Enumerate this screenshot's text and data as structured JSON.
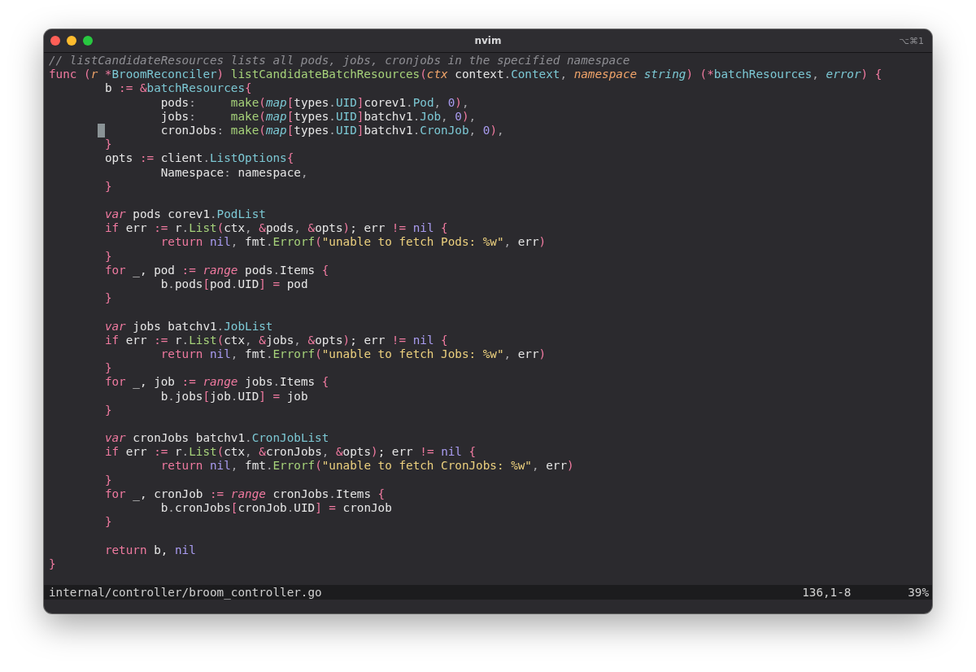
{
  "window": {
    "title": "nvim",
    "shortcut": "⌥⌘1"
  },
  "lines": [
    {
      "kind": "code",
      "cursor": false,
      "tokens": [
        {
          "text": "// listCandidateResources lists all pods, jobs, cronjobs in the specified namespace",
          "kind": "comment"
        }
      ]
    },
    {
      "kind": "code",
      "cursor": false,
      "tokens": [
        {
          "text": "func",
          "kind": "keyword"
        },
        {
          "text": " (",
          "kind": "op"
        },
        {
          "text": "r",
          "kind": "param"
        },
        {
          "text": " *",
          "kind": "op"
        },
        {
          "text": "BroomReconciler",
          "kind": "type"
        },
        {
          "text": ") ",
          "kind": "op"
        },
        {
          "text": "listCandidateBatchResources",
          "kind": "func"
        },
        {
          "text": "(",
          "kind": "op"
        },
        {
          "text": "ctx",
          "kind": "param"
        },
        {
          "text": " context",
          "kind": "plain"
        },
        {
          "text": ".",
          "kind": "punct"
        },
        {
          "text": "Context",
          "kind": "type"
        },
        {
          "text": ", ",
          "kind": "punct"
        },
        {
          "text": "namespace",
          "kind": "param"
        },
        {
          "text": " string",
          "kind": "type-italic"
        },
        {
          "text": ") (*",
          "kind": "op"
        },
        {
          "text": "batchResources",
          "kind": "type"
        },
        {
          "text": ", ",
          "kind": "punct"
        },
        {
          "text": "error",
          "kind": "type-italic"
        },
        {
          "text": ") {",
          "kind": "op"
        }
      ]
    },
    {
      "kind": "code",
      "cursor": false,
      "tokens": [
        {
          "text": "\tb ",
          "kind": "plain"
        },
        {
          "text": ":= &",
          "kind": "op"
        },
        {
          "text": "batchResources",
          "kind": "type"
        },
        {
          "text": "{",
          "kind": "op"
        }
      ]
    },
    {
      "kind": "code",
      "cursor": false,
      "tokens": [
        {
          "text": "\t\tpods",
          "kind": "plain"
        },
        {
          "text": ":     ",
          "kind": "punct"
        },
        {
          "text": "make",
          "kind": "func"
        },
        {
          "text": "(",
          "kind": "op"
        },
        {
          "text": "map",
          "kind": "type-italic"
        },
        {
          "text": "[",
          "kind": "op"
        },
        {
          "text": "types",
          "kind": "plain"
        },
        {
          "text": ".",
          "kind": "punct"
        },
        {
          "text": "UID",
          "kind": "type"
        },
        {
          "text": "]",
          "kind": "op"
        },
        {
          "text": "corev1",
          "kind": "plain"
        },
        {
          "text": ".",
          "kind": "punct"
        },
        {
          "text": "Pod",
          "kind": "type"
        },
        {
          "text": ", ",
          "kind": "punct"
        },
        {
          "text": "0",
          "kind": "const"
        },
        {
          "text": ")",
          "kind": "op"
        },
        {
          "text": ",",
          "kind": "punct"
        }
      ]
    },
    {
      "kind": "code",
      "cursor": false,
      "tokens": [
        {
          "text": "\t\tjobs",
          "kind": "plain"
        },
        {
          "text": ":     ",
          "kind": "punct"
        },
        {
          "text": "make",
          "kind": "func"
        },
        {
          "text": "(",
          "kind": "op"
        },
        {
          "text": "map",
          "kind": "type-italic"
        },
        {
          "text": "[",
          "kind": "op"
        },
        {
          "text": "types",
          "kind": "plain"
        },
        {
          "text": ".",
          "kind": "punct"
        },
        {
          "text": "UID",
          "kind": "type"
        },
        {
          "text": "]",
          "kind": "op"
        },
        {
          "text": "batchv1",
          "kind": "plain"
        },
        {
          "text": ".",
          "kind": "punct"
        },
        {
          "text": "Job",
          "kind": "type"
        },
        {
          "text": ", ",
          "kind": "punct"
        },
        {
          "text": "0",
          "kind": "const"
        },
        {
          "text": ")",
          "kind": "op"
        },
        {
          "text": ",",
          "kind": "punct"
        }
      ]
    },
    {
      "kind": "code",
      "cursor": true,
      "tokens": [
        {
          "text": "\t\tcronJobs",
          "kind": "plain"
        },
        {
          "text": ": ",
          "kind": "punct"
        },
        {
          "text": "make",
          "kind": "func"
        },
        {
          "text": "(",
          "kind": "op"
        },
        {
          "text": "map",
          "kind": "type-italic"
        },
        {
          "text": "[",
          "kind": "op"
        },
        {
          "text": "types",
          "kind": "plain"
        },
        {
          "text": ".",
          "kind": "punct"
        },
        {
          "text": "UID",
          "kind": "type"
        },
        {
          "text": "]",
          "kind": "op"
        },
        {
          "text": "batchv1",
          "kind": "plain"
        },
        {
          "text": ".",
          "kind": "punct"
        },
        {
          "text": "CronJob",
          "kind": "type"
        },
        {
          "text": ", ",
          "kind": "punct"
        },
        {
          "text": "0",
          "kind": "const"
        },
        {
          "text": ")",
          "kind": "op"
        },
        {
          "text": ",",
          "kind": "punct"
        }
      ]
    },
    {
      "kind": "code",
      "cursor": false,
      "tokens": [
        {
          "text": "\t}",
          "kind": "op"
        }
      ]
    },
    {
      "kind": "code",
      "cursor": false,
      "tokens": [
        {
          "text": "\topts ",
          "kind": "plain"
        },
        {
          "text": ":= ",
          "kind": "op"
        },
        {
          "text": "client",
          "kind": "plain"
        },
        {
          "text": ".",
          "kind": "punct"
        },
        {
          "text": "ListOptions",
          "kind": "type"
        },
        {
          "text": "{",
          "kind": "op"
        }
      ]
    },
    {
      "kind": "code",
      "cursor": false,
      "tokens": [
        {
          "text": "\t\tNamespace",
          "kind": "plain"
        },
        {
          "text": ": ",
          "kind": "punct"
        },
        {
          "text": "namespace",
          "kind": "plain"
        },
        {
          "text": ",",
          "kind": "punct"
        }
      ]
    },
    {
      "kind": "code",
      "cursor": false,
      "tokens": [
        {
          "text": "\t}",
          "kind": "op"
        }
      ]
    },
    {
      "kind": "blank"
    },
    {
      "kind": "code",
      "cursor": false,
      "tokens": [
        {
          "text": "\tvar",
          "kind": "keyword-italic"
        },
        {
          "text": " pods corev1",
          "kind": "plain"
        },
        {
          "text": ".",
          "kind": "punct"
        },
        {
          "text": "PodList",
          "kind": "type"
        }
      ]
    },
    {
      "kind": "code",
      "cursor": false,
      "tokens": [
        {
          "text": "\tif",
          "kind": "keyword"
        },
        {
          "text": " err ",
          "kind": "plain"
        },
        {
          "text": ":= ",
          "kind": "op"
        },
        {
          "text": "r",
          "kind": "plain"
        },
        {
          "text": ".",
          "kind": "punct"
        },
        {
          "text": "List",
          "kind": "func"
        },
        {
          "text": "(",
          "kind": "op"
        },
        {
          "text": "ctx",
          "kind": "plain"
        },
        {
          "text": ", ",
          "kind": "punct"
        },
        {
          "text": "&",
          "kind": "op"
        },
        {
          "text": "pods",
          "kind": "plain"
        },
        {
          "text": ", ",
          "kind": "punct"
        },
        {
          "text": "&",
          "kind": "op"
        },
        {
          "text": "opts",
          "kind": "plain"
        },
        {
          "text": ")",
          "kind": "op"
        },
        {
          "text": "; err ",
          "kind": "plain"
        },
        {
          "text": "!= ",
          "kind": "op"
        },
        {
          "text": "nil",
          "kind": "const"
        },
        {
          "text": " {",
          "kind": "op"
        }
      ]
    },
    {
      "kind": "code",
      "cursor": false,
      "tokens": [
        {
          "text": "\t\treturn",
          "kind": "keyword"
        },
        {
          "text": " nil",
          "kind": "const"
        },
        {
          "text": ", ",
          "kind": "punct"
        },
        {
          "text": "fmt",
          "kind": "plain"
        },
        {
          "text": ".",
          "kind": "punct"
        },
        {
          "text": "Errorf",
          "kind": "func"
        },
        {
          "text": "(",
          "kind": "op"
        },
        {
          "text": "\"unable to fetch Pods: %w\"",
          "kind": "string"
        },
        {
          "text": ", ",
          "kind": "punct"
        },
        {
          "text": "err",
          "kind": "plain"
        },
        {
          "text": ")",
          "kind": "op"
        }
      ]
    },
    {
      "kind": "code",
      "cursor": false,
      "tokens": [
        {
          "text": "\t}",
          "kind": "op"
        }
      ]
    },
    {
      "kind": "code",
      "cursor": false,
      "tokens": [
        {
          "text": "\tfor",
          "kind": "keyword"
        },
        {
          "text": " _, pod ",
          "kind": "plain"
        },
        {
          "text": ":= ",
          "kind": "op"
        },
        {
          "text": "range",
          "kind": "keyword-italic"
        },
        {
          "text": " pods",
          "kind": "plain"
        },
        {
          "text": ".",
          "kind": "punct"
        },
        {
          "text": "Items",
          "kind": "plain"
        },
        {
          "text": " {",
          "kind": "op"
        }
      ]
    },
    {
      "kind": "code",
      "cursor": false,
      "tokens": [
        {
          "text": "\t\tb",
          "kind": "plain"
        },
        {
          "text": ".",
          "kind": "punct"
        },
        {
          "text": "pods",
          "kind": "plain"
        },
        {
          "text": "[",
          "kind": "op"
        },
        {
          "text": "pod",
          "kind": "plain"
        },
        {
          "text": ".",
          "kind": "punct"
        },
        {
          "text": "UID",
          "kind": "plain"
        },
        {
          "text": "] = ",
          "kind": "op"
        },
        {
          "text": "pod",
          "kind": "plain"
        }
      ]
    },
    {
      "kind": "code",
      "cursor": false,
      "tokens": [
        {
          "text": "\t}",
          "kind": "op"
        }
      ]
    },
    {
      "kind": "blank"
    },
    {
      "kind": "code",
      "cursor": false,
      "tokens": [
        {
          "text": "\tvar",
          "kind": "keyword-italic"
        },
        {
          "text": " jobs batchv1",
          "kind": "plain"
        },
        {
          "text": ".",
          "kind": "punct"
        },
        {
          "text": "JobList",
          "kind": "type"
        }
      ]
    },
    {
      "kind": "code",
      "cursor": false,
      "tokens": [
        {
          "text": "\tif",
          "kind": "keyword"
        },
        {
          "text": " err ",
          "kind": "plain"
        },
        {
          "text": ":= ",
          "kind": "op"
        },
        {
          "text": "r",
          "kind": "plain"
        },
        {
          "text": ".",
          "kind": "punct"
        },
        {
          "text": "List",
          "kind": "func"
        },
        {
          "text": "(",
          "kind": "op"
        },
        {
          "text": "ctx",
          "kind": "plain"
        },
        {
          "text": ", ",
          "kind": "punct"
        },
        {
          "text": "&",
          "kind": "op"
        },
        {
          "text": "jobs",
          "kind": "plain"
        },
        {
          "text": ", ",
          "kind": "punct"
        },
        {
          "text": "&",
          "kind": "op"
        },
        {
          "text": "opts",
          "kind": "plain"
        },
        {
          "text": ")",
          "kind": "op"
        },
        {
          "text": "; err ",
          "kind": "plain"
        },
        {
          "text": "!= ",
          "kind": "op"
        },
        {
          "text": "nil",
          "kind": "const"
        },
        {
          "text": " {",
          "kind": "op"
        }
      ]
    },
    {
      "kind": "code",
      "cursor": false,
      "tokens": [
        {
          "text": "\t\treturn",
          "kind": "keyword"
        },
        {
          "text": " nil",
          "kind": "const"
        },
        {
          "text": ", ",
          "kind": "punct"
        },
        {
          "text": "fmt",
          "kind": "plain"
        },
        {
          "text": ".",
          "kind": "punct"
        },
        {
          "text": "Errorf",
          "kind": "func"
        },
        {
          "text": "(",
          "kind": "op"
        },
        {
          "text": "\"unable to fetch Jobs: %w\"",
          "kind": "string"
        },
        {
          "text": ", ",
          "kind": "punct"
        },
        {
          "text": "err",
          "kind": "plain"
        },
        {
          "text": ")",
          "kind": "op"
        }
      ]
    },
    {
      "kind": "code",
      "cursor": false,
      "tokens": [
        {
          "text": "\t}",
          "kind": "op"
        }
      ]
    },
    {
      "kind": "code",
      "cursor": false,
      "tokens": [
        {
          "text": "\tfor",
          "kind": "keyword"
        },
        {
          "text": " _, job ",
          "kind": "plain"
        },
        {
          "text": ":= ",
          "kind": "op"
        },
        {
          "text": "range",
          "kind": "keyword-italic"
        },
        {
          "text": " jobs",
          "kind": "plain"
        },
        {
          "text": ".",
          "kind": "punct"
        },
        {
          "text": "Items",
          "kind": "plain"
        },
        {
          "text": " {",
          "kind": "op"
        }
      ]
    },
    {
      "kind": "code",
      "cursor": false,
      "tokens": [
        {
          "text": "\t\tb",
          "kind": "plain"
        },
        {
          "text": ".",
          "kind": "punct"
        },
        {
          "text": "jobs",
          "kind": "plain"
        },
        {
          "text": "[",
          "kind": "op"
        },
        {
          "text": "job",
          "kind": "plain"
        },
        {
          "text": ".",
          "kind": "punct"
        },
        {
          "text": "UID",
          "kind": "plain"
        },
        {
          "text": "] = ",
          "kind": "op"
        },
        {
          "text": "job",
          "kind": "plain"
        }
      ]
    },
    {
      "kind": "code",
      "cursor": false,
      "tokens": [
        {
          "text": "\t}",
          "kind": "op"
        }
      ]
    },
    {
      "kind": "blank"
    },
    {
      "kind": "code",
      "cursor": false,
      "tokens": [
        {
          "text": "\tvar",
          "kind": "keyword-italic"
        },
        {
          "text": " cronJobs batchv1",
          "kind": "plain"
        },
        {
          "text": ".",
          "kind": "punct"
        },
        {
          "text": "CronJobList",
          "kind": "type"
        }
      ]
    },
    {
      "kind": "code",
      "cursor": false,
      "tokens": [
        {
          "text": "\tif",
          "kind": "keyword"
        },
        {
          "text": " err ",
          "kind": "plain"
        },
        {
          "text": ":= ",
          "kind": "op"
        },
        {
          "text": "r",
          "kind": "plain"
        },
        {
          "text": ".",
          "kind": "punct"
        },
        {
          "text": "List",
          "kind": "func"
        },
        {
          "text": "(",
          "kind": "op"
        },
        {
          "text": "ctx",
          "kind": "plain"
        },
        {
          "text": ", ",
          "kind": "punct"
        },
        {
          "text": "&",
          "kind": "op"
        },
        {
          "text": "cronJobs",
          "kind": "plain"
        },
        {
          "text": ", ",
          "kind": "punct"
        },
        {
          "text": "&",
          "kind": "op"
        },
        {
          "text": "opts",
          "kind": "plain"
        },
        {
          "text": ")",
          "kind": "op"
        },
        {
          "text": "; err ",
          "kind": "plain"
        },
        {
          "text": "!= ",
          "kind": "op"
        },
        {
          "text": "nil",
          "kind": "const"
        },
        {
          "text": " {",
          "kind": "op"
        }
      ]
    },
    {
      "kind": "code",
      "cursor": false,
      "tokens": [
        {
          "text": "\t\treturn",
          "kind": "keyword"
        },
        {
          "text": " nil",
          "kind": "const"
        },
        {
          "text": ", ",
          "kind": "punct"
        },
        {
          "text": "fmt",
          "kind": "plain"
        },
        {
          "text": ".",
          "kind": "punct"
        },
        {
          "text": "Errorf",
          "kind": "func"
        },
        {
          "text": "(",
          "kind": "op"
        },
        {
          "text": "\"unable to fetch CronJobs: %w\"",
          "kind": "string"
        },
        {
          "text": ", ",
          "kind": "punct"
        },
        {
          "text": "err",
          "kind": "plain"
        },
        {
          "text": ")",
          "kind": "op"
        }
      ]
    },
    {
      "kind": "code",
      "cursor": false,
      "tokens": [
        {
          "text": "\t}",
          "kind": "op"
        }
      ]
    },
    {
      "kind": "code",
      "cursor": false,
      "tokens": [
        {
          "text": "\tfor",
          "kind": "keyword"
        },
        {
          "text": " _, cronJob ",
          "kind": "plain"
        },
        {
          "text": ":= ",
          "kind": "op"
        },
        {
          "text": "range",
          "kind": "keyword-italic"
        },
        {
          "text": " cronJobs",
          "kind": "plain"
        },
        {
          "text": ".",
          "kind": "punct"
        },
        {
          "text": "Items",
          "kind": "plain"
        },
        {
          "text": " {",
          "kind": "op"
        }
      ]
    },
    {
      "kind": "code",
      "cursor": false,
      "tokens": [
        {
          "text": "\t\tb",
          "kind": "plain"
        },
        {
          "text": ".",
          "kind": "punct"
        },
        {
          "text": "cronJobs",
          "kind": "plain"
        },
        {
          "text": "[",
          "kind": "op"
        },
        {
          "text": "cronJob",
          "kind": "plain"
        },
        {
          "text": ".",
          "kind": "punct"
        },
        {
          "text": "UID",
          "kind": "plain"
        },
        {
          "text": "] = ",
          "kind": "op"
        },
        {
          "text": "cronJob",
          "kind": "plain"
        }
      ]
    },
    {
      "kind": "code",
      "cursor": false,
      "tokens": [
        {
          "text": "\t}",
          "kind": "op"
        }
      ]
    },
    {
      "kind": "blank"
    },
    {
      "kind": "code",
      "cursor": false,
      "tokens": [
        {
          "text": "\treturn",
          "kind": "keyword"
        },
        {
          "text": " b, ",
          "kind": "plain"
        },
        {
          "text": "nil",
          "kind": "const"
        }
      ]
    },
    {
      "kind": "code",
      "cursor": false,
      "tokens": [
        {
          "text": "}",
          "kind": "op"
        }
      ]
    }
  ],
  "status_bar": {
    "file": "internal/controller/broom_controller.go",
    "position": "136,1-8",
    "scroll": "39%"
  }
}
